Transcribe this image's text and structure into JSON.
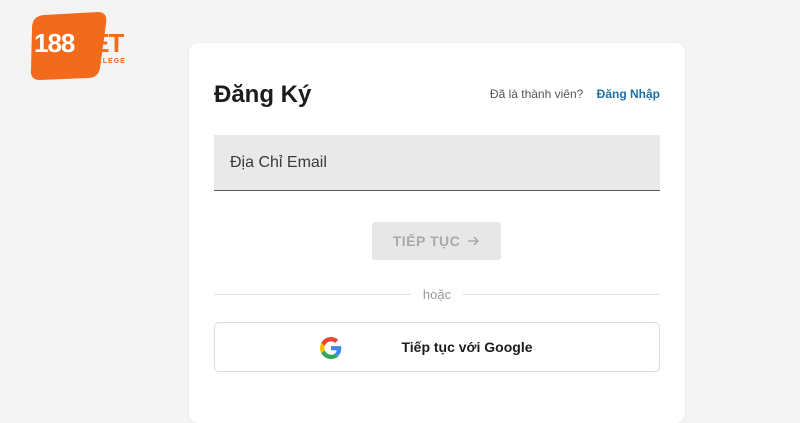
{
  "brand": {
    "logo_number": "188",
    "logo_bet": "BET",
    "logo_sub": "COLLEGE",
    "accent_color": "#f26a1b"
  },
  "signup": {
    "title": "Đăng Ký",
    "member_prompt": "Đã là thành viên?",
    "login_link": "Đăng Nhập",
    "email_placeholder": "Địa Chỉ Email",
    "email_value": "",
    "continue_label": "TIẾP TỤC",
    "continue_icon": "arrow-right-icon",
    "or_text": "hoặc",
    "google_label": "Tiếp tục với Google",
    "google_icon": "google-icon"
  }
}
